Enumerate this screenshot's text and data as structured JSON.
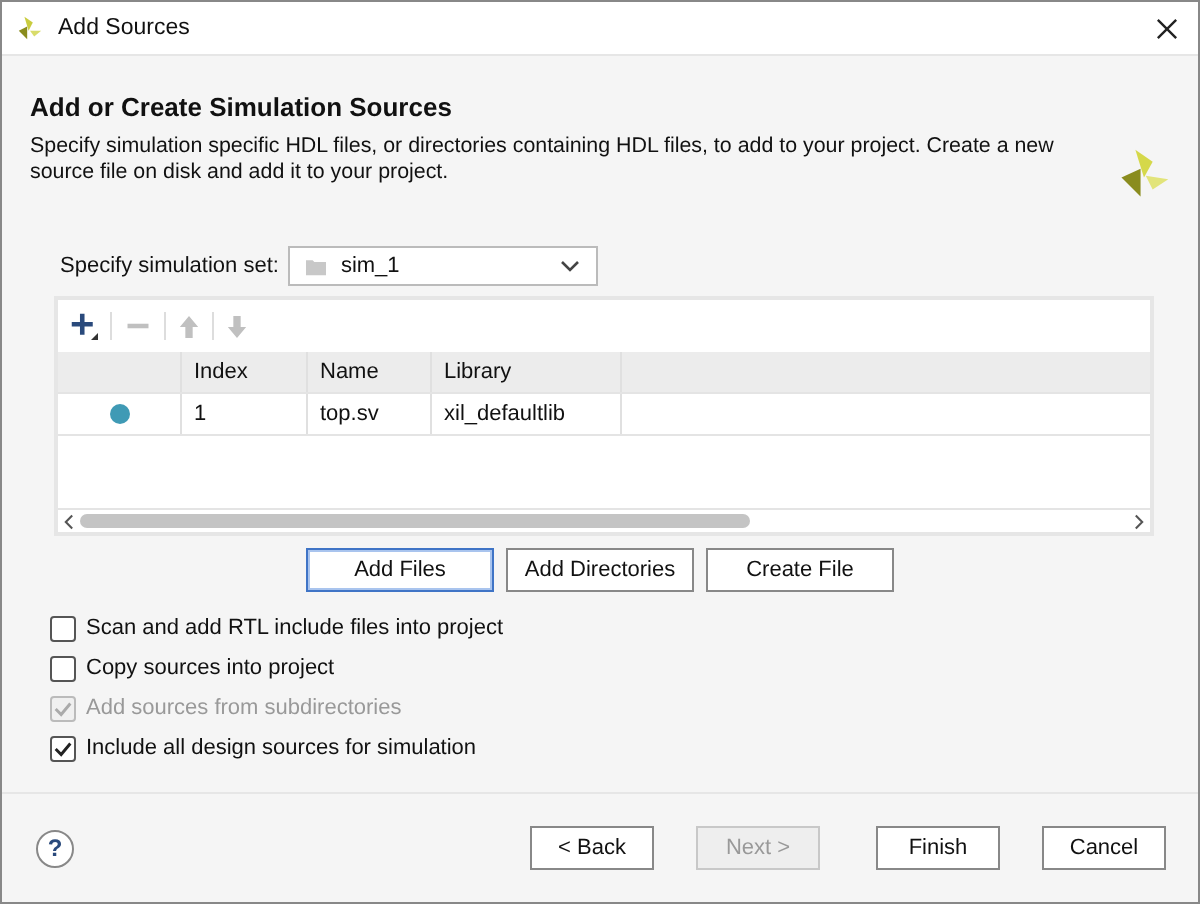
{
  "window": {
    "title": "Add Sources"
  },
  "header": {
    "title": "Add or Create Simulation Sources",
    "description": "Specify simulation specific HDL files, or directories containing HDL files, to add to your project. Create a new source file on disk and add it to your project."
  },
  "simulation_set": {
    "label": "Specify simulation set:",
    "value": "sim_1"
  },
  "toolbar": [
    {
      "kind": "add",
      "disabled": false
    },
    {
      "kind": "remove",
      "disabled": true
    },
    {
      "kind": "up",
      "disabled": true
    },
    {
      "kind": "down",
      "disabled": true
    }
  ],
  "table": {
    "columns": [
      "Index",
      "Name",
      "Library"
    ],
    "rows": [
      {
        "color": "#3f9ab5",
        "cells": [
          "1",
          "top.sv",
          "xil_defaultlib"
        ]
      }
    ]
  },
  "file_buttons": [
    {
      "label": "Add Files",
      "default": true
    },
    {
      "label": "Add Directories",
      "default": false
    },
    {
      "label": "Create File",
      "default": false
    }
  ],
  "options": [
    {
      "label": "Scan and add RTL include files into project",
      "checked": false,
      "disabled": false
    },
    {
      "label": "Copy sources into project",
      "checked": false,
      "disabled": false
    },
    {
      "label": "Add sources from subdirectories",
      "checked": true,
      "disabled": true
    },
    {
      "label": "Include all design sources for simulation",
      "checked": true,
      "disabled": false
    }
  ],
  "help": "?",
  "nav_buttons": [
    {
      "label": "< Back",
      "disabled": false
    },
    {
      "label": "Next >",
      "disabled": true
    },
    {
      "label": "Finish",
      "disabled": false
    },
    {
      "label": "Cancel",
      "disabled": false
    }
  ]
}
